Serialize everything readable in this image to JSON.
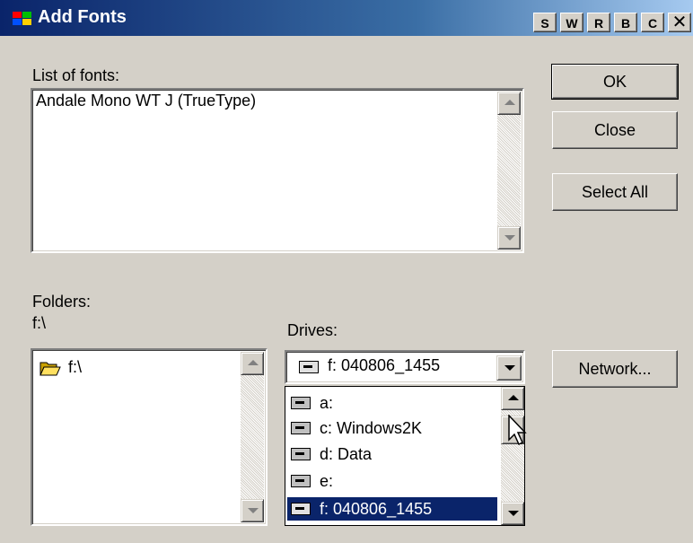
{
  "window": {
    "title": "Add Fonts",
    "title_buttons": [
      "S",
      "W",
      "R",
      "B",
      "C",
      "✕"
    ]
  },
  "fonts": {
    "label": "List of fonts:",
    "items": [
      "Andale Mono WT J (TrueType)"
    ]
  },
  "buttons": {
    "ok": "OK",
    "close": "Close",
    "select_all": "Select All",
    "network": "Network..."
  },
  "folders": {
    "label": "Folders:",
    "current_path": "f:\\",
    "items": [
      "f:\\"
    ]
  },
  "drives": {
    "label": "Drives:",
    "selected": "f: 040806_1455",
    "options": [
      "a:",
      "c: Windows2K",
      "d: Data",
      "e:",
      "f: 040806_1455"
    ],
    "highlighted_index": 4
  },
  "icons": [
    "app-logo-icon",
    "folder-open-icon",
    "drive-icon",
    "cdrom-icon",
    "mouse-cursor-icon"
  ]
}
